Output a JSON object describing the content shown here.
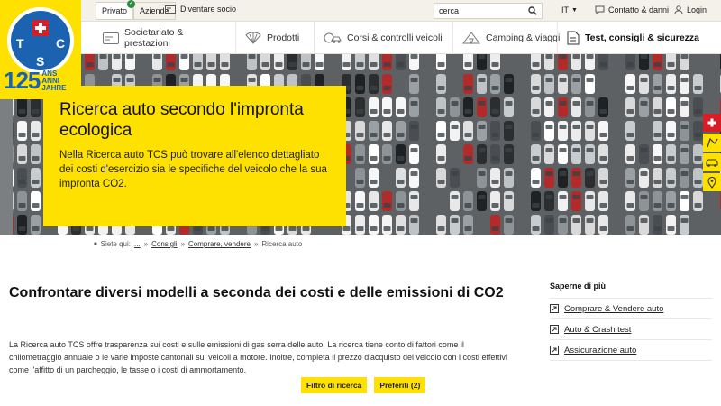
{
  "brand": {
    "logo_letters": [
      "T",
      "C",
      "S"
    ],
    "anniversary_number": "125",
    "anniversary_words": [
      "ANS",
      "ANNI",
      "JAHRE"
    ]
  },
  "topbar": {
    "segments": [
      "Privato",
      "Aziende"
    ],
    "member_label": "Diventare socio",
    "search": {
      "value": "cerca"
    },
    "language": "IT",
    "contact_label": "Contatto & danni",
    "login_label": "Login"
  },
  "nav": {
    "items": [
      {
        "label": "Societariato & prestazioni",
        "icon": "card-icon"
      },
      {
        "label": "Prodotti",
        "icon": "shell-icon"
      },
      {
        "label": "Corsi & controlli veicoli",
        "icon": "car-course-icon"
      },
      {
        "label": "Camping & viaggi",
        "icon": "tent-icon"
      },
      {
        "label": "Test, consigli & sicurezza",
        "icon": "document-icon"
      }
    ]
  },
  "hero": {
    "title": "Ricerca auto secondo l'impronta ecologica",
    "text": "Nella Ricerca auto TCS può trovare all'elenco dettagliato dei costi d'esercizio sia le specifiche del veicolo che la sua impronta CO2."
  },
  "breadcrumb": {
    "prefix": "Siete qui:",
    "home": "...",
    "items": [
      "Consigli",
      "Comprare, vendere",
      "Ricerca auto"
    ]
  },
  "content": {
    "title": "Confrontare diversi modelli a seconda dei costi e delle emissioni di CO2",
    "body": "La Ricerca auto TCS offre trasparenza sui costi e sulle emissioni di gas serra delle auto. La ricerca tiene conto di fattori come il chilometraggio annuale o le varie imposte cantonali sui veicoli a motore. Inoltre, completa il prezzo d'acquisto del veicolo con i costi effettivi come l'affitto di un parcheggio, le tasse o i costi di ammortamento."
  },
  "aside": {
    "title": "Saperne di più",
    "links": [
      "Comprare & Vendere auto",
      "Auto & Crash test",
      "Assicurazione auto"
    ]
  },
  "buttons": {
    "filter": "Filtro di ricerca",
    "favorites": "Preferiti (2)"
  },
  "colors": {
    "accent": "#ffe100",
    "brand_blue": "#1b62b0",
    "swiss_red": "#d61e28"
  }
}
